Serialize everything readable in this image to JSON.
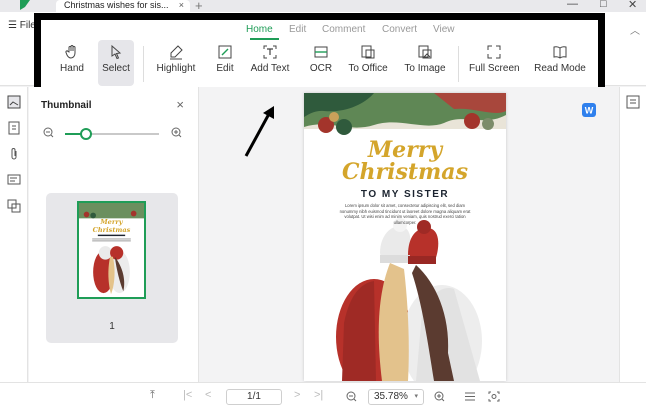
{
  "window": {
    "tab_title": "Christmas wishes for sis...",
    "tab_close": "×",
    "new_tab": "+",
    "minimize": "—",
    "maximize": "□",
    "close": "✕"
  },
  "menubar": {
    "file_label": "File",
    "collapse_glyph": "︿"
  },
  "ribbon": {
    "tabs": [
      {
        "label": "Home",
        "active": true
      },
      {
        "label": "Edit",
        "active": false
      },
      {
        "label": "Comment",
        "active": false
      },
      {
        "label": "Convert",
        "active": false
      },
      {
        "label": "View",
        "active": false
      }
    ],
    "tools": [
      {
        "label": "Hand",
        "icon": "hand-icon",
        "active": false
      },
      {
        "label": "Select",
        "icon": "cursor-icon",
        "active": true
      },
      {
        "label": "Highlight",
        "icon": "highlighter-icon",
        "active": false
      },
      {
        "label": "Edit",
        "icon": "edit-icon",
        "active": false
      },
      {
        "label": "Add Text",
        "icon": "add-text-icon",
        "active": false
      },
      {
        "label": "OCR",
        "icon": "ocr-icon",
        "active": false
      },
      {
        "label": "To Office",
        "icon": "to-office-icon",
        "active": false
      },
      {
        "label": "To Image",
        "icon": "to-image-icon",
        "active": false
      },
      {
        "label": "Full Screen",
        "icon": "full-screen-icon",
        "active": false
      },
      {
        "label": "Read Mode",
        "icon": "book-icon",
        "active": false
      }
    ]
  },
  "thumbnail_panel": {
    "title": "Thumbnail",
    "close_glyph": "×",
    "zoom_level_fraction": 0.22,
    "page_number": "1"
  },
  "document": {
    "cover_line1": "Merry",
    "cover_line2": "Christmas",
    "cover_subtitle": "TO MY SISTER",
    "cover_body": "Lorem ipsum dolor sit amet, consectetur adipiscing elit, sed diam nonummy nibh euismod tincidunt ut laoreet dolore magna aliquam erat volutpat. Ut wisi enim ad minim veniam, quis nostrud exerci tation ullamcorper."
  },
  "bottom_bar": {
    "page_indicator": "1/1",
    "zoom_value": "35.78%",
    "zoom_caret": "▾"
  },
  "colors": {
    "accent": "#1f9d57",
    "gold": "#d4a52b",
    "annotation_border": "#000000"
  }
}
